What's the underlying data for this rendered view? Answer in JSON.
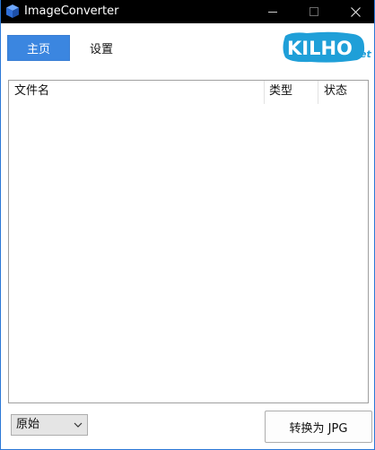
{
  "window": {
    "title": "ImageConverter",
    "accent_color": "#2b78d6",
    "icons": {
      "app": "app-cube-icon",
      "minimize": "minimize-icon",
      "maximize": "maximize-icon",
      "close": "close-icon"
    }
  },
  "toolbar": {
    "home_label": "主页",
    "settings_label": "设置",
    "home_color": "#3b86e0"
  },
  "logo": {
    "text_main": "KILHO",
    "text_suffix": ".net",
    "color": "#1f9fd8"
  },
  "file_list": {
    "columns": [
      "文件名",
      "类型",
      "状态"
    ],
    "rows": []
  },
  "footer": {
    "format_select": {
      "selected": "原始",
      "icon": "chevron-down-icon"
    },
    "convert_label": "转换为 JPG"
  }
}
